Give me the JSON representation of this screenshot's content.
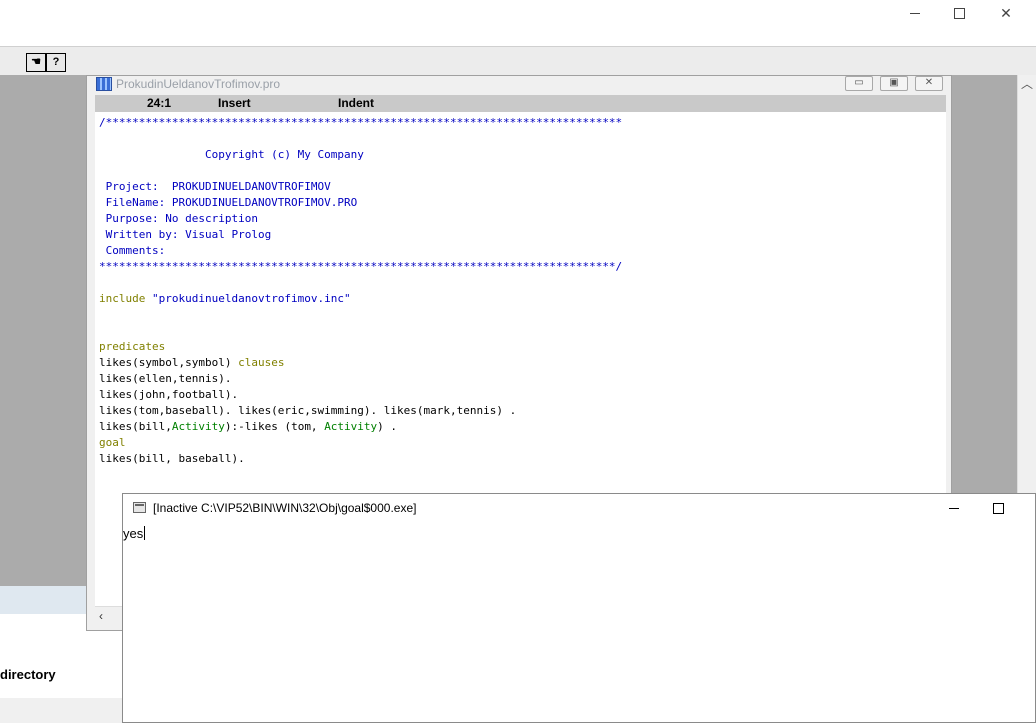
{
  "ide": {
    "toolbar_icons": [
      "window-hand-icon",
      "help-question-icon"
    ],
    "help_glyph": "?",
    "directory_label": "directory"
  },
  "editor": {
    "title": "ProkudinUeldanovTrofimov.pro",
    "status": {
      "position": "24:1",
      "mode": "Insert",
      "indent": "Indent"
    },
    "code_lines": [
      "/******************************************************************************",
      "",
      "                Copyright (c) My Company",
      "",
      " Project:  PROKUDINUELDANOVTROFIMOV",
      " FileName: PROKUDINUELDANOVTROFIMOV.PRO",
      " Purpose: No description",
      " Written by: Visual Prolog",
      " Comments:",
      "******************************************************************************/",
      "",
      "include \"prokudinueldanovtrofimov.inc\"",
      "",
      "",
      "predicates",
      "likes(symbol,symbol) clauses",
      "likes(ellen,tennis).",
      "likes(john,football).",
      "likes(tom,baseball). likes(eric,swimming). likes(mark,tennis) .",
      "likes(bill,Activity):-likes (tom, Activity) .",
      "goal",
      "likes(bill, baseball)."
    ]
  },
  "console": {
    "title": "[Inactive C:\\VIP52\\BIN\\WIN\\32\\Obj\\goal$000.exe]",
    "output": "yes"
  },
  "colors": {
    "comment": "#0000c0",
    "keyword": "#808000",
    "variable": "#008000",
    "mdi_background": "#ababab"
  }
}
